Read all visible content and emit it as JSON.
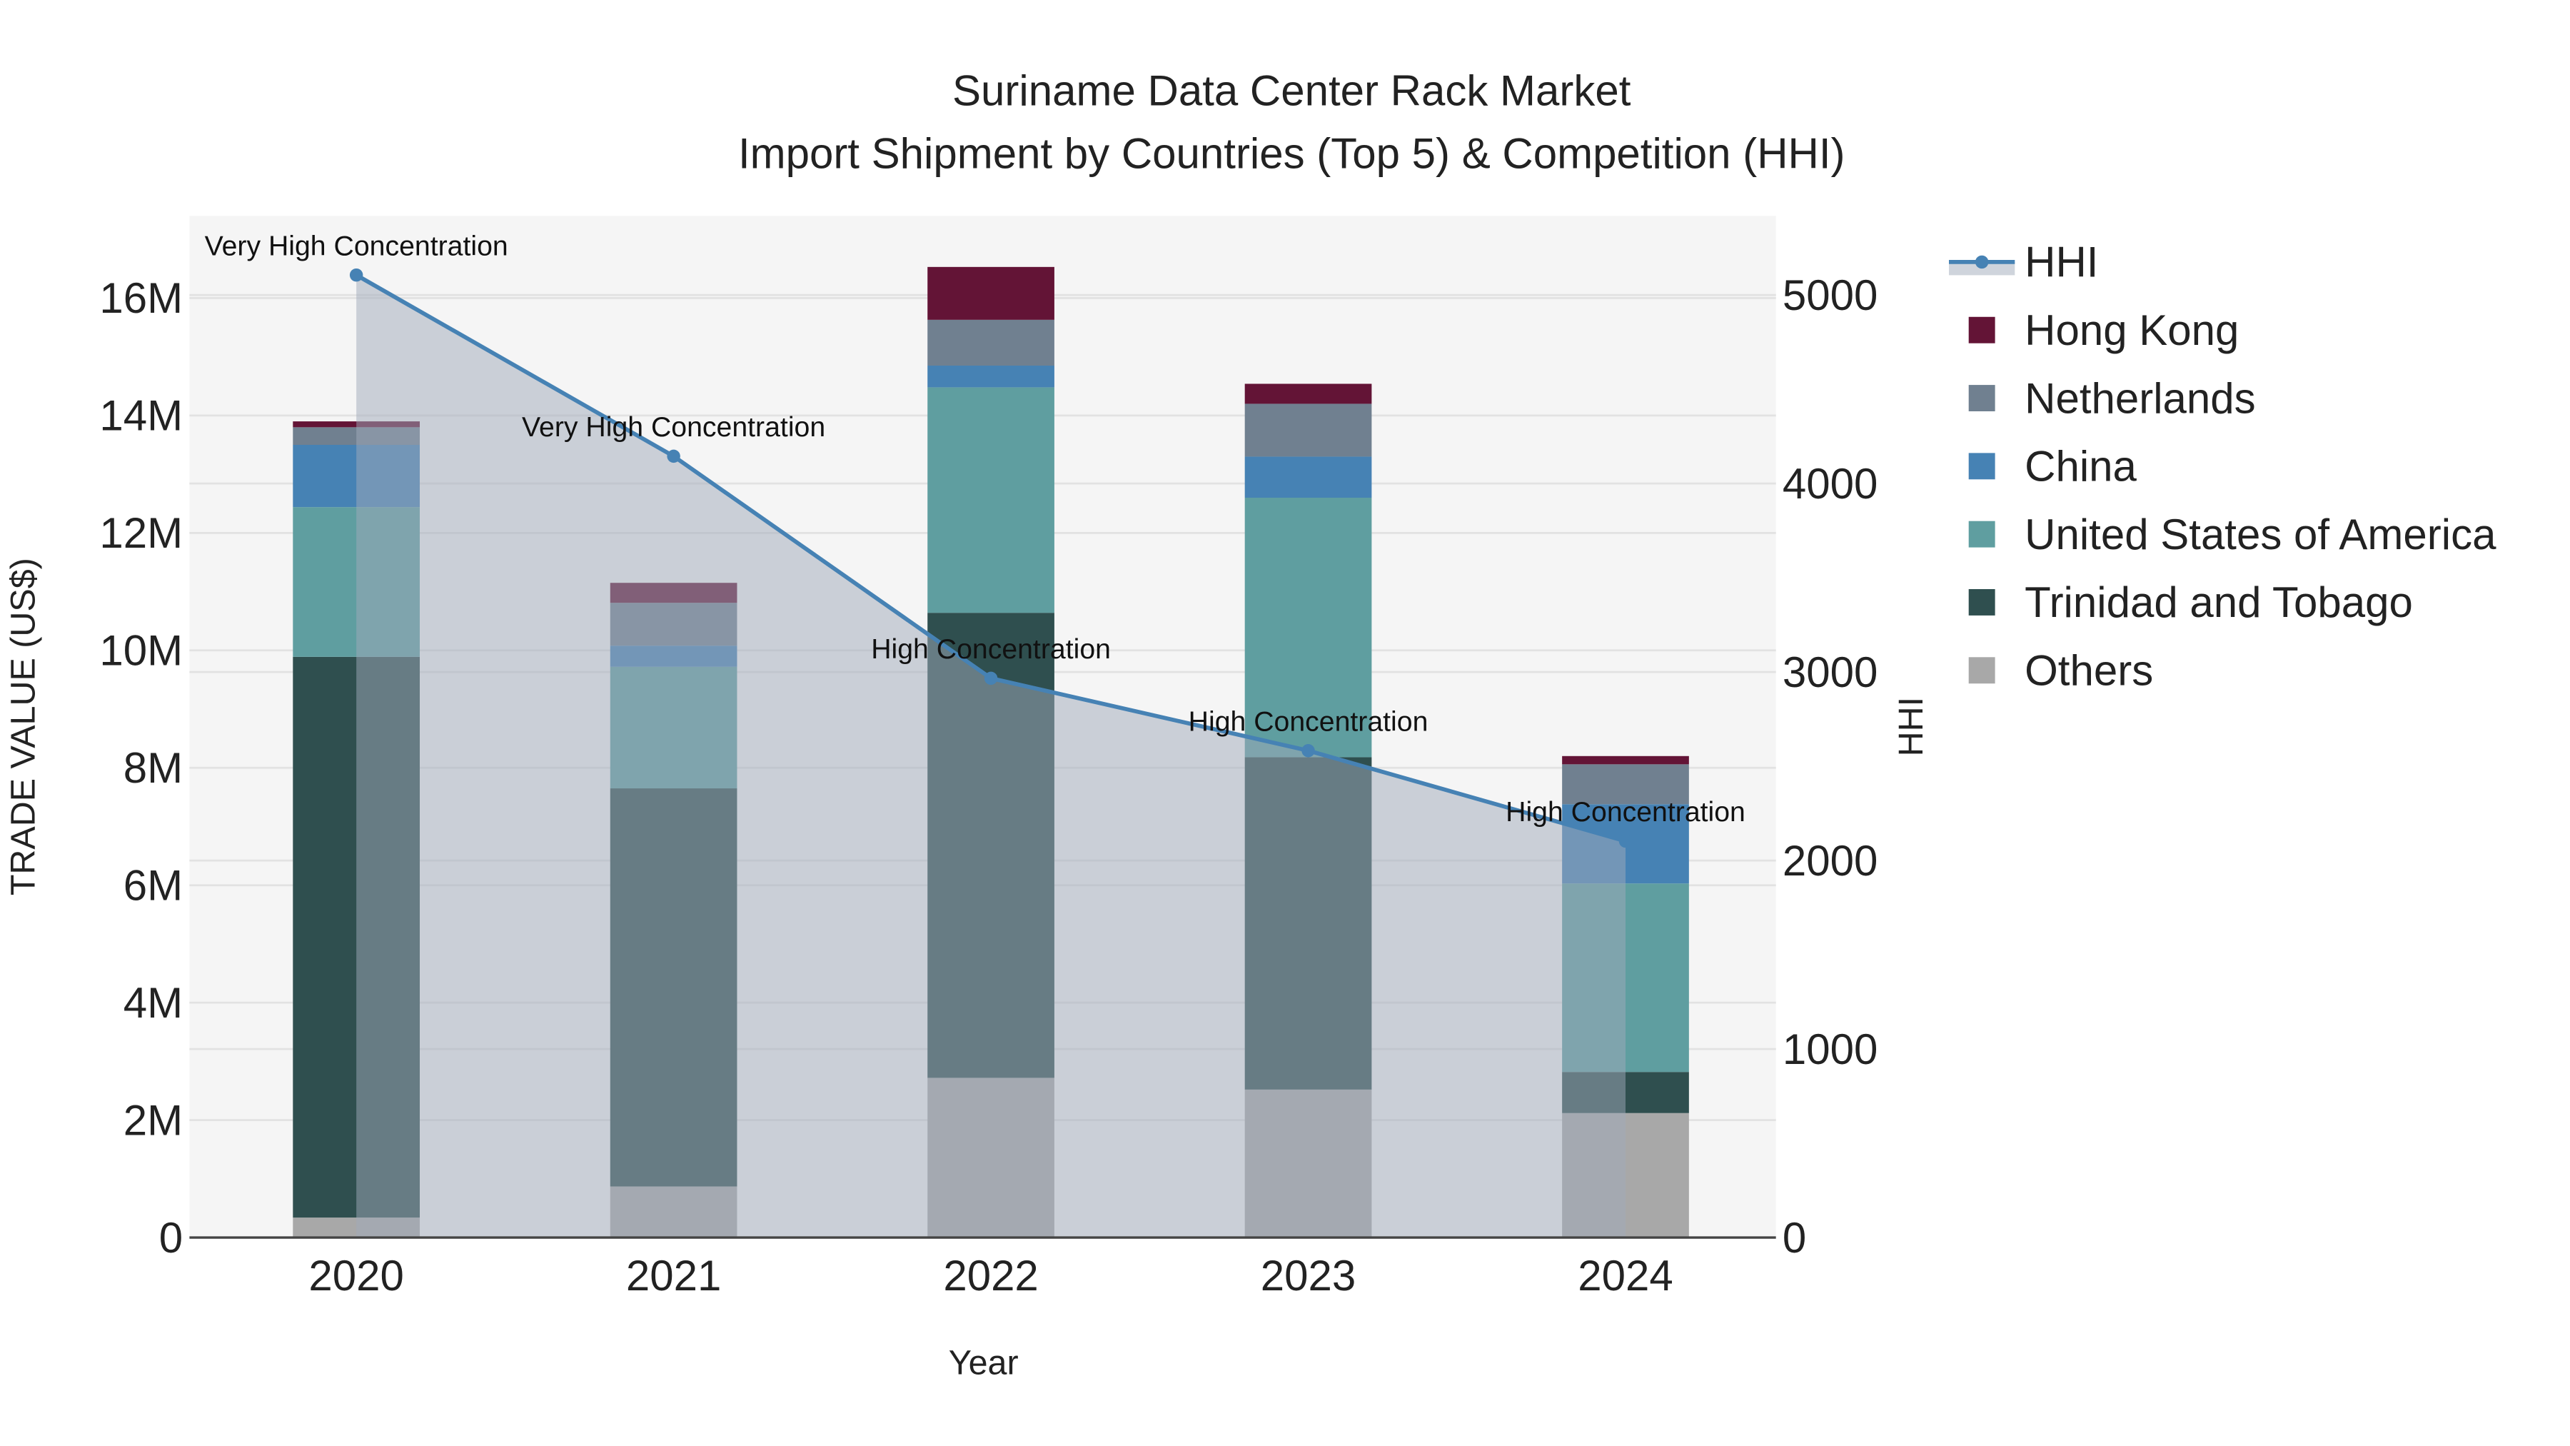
{
  "chart_data": {
    "type": "bar",
    "title_line1": "Suriname Data Center Rack Market",
    "title_line2": "Import Shipment by Countries (Top 5) & Competition (HHI)",
    "xlabel": "Year",
    "ylabel": "TRADE VALUE (US$)",
    "y2label": "HHI",
    "categories": [
      "2020",
      "2021",
      "2022",
      "2023",
      "2024"
    ],
    "ylim": [
      0,
      17400000
    ],
    "y2lim": [
      0,
      5420
    ],
    "yticks": [
      0,
      2000000,
      4000000,
      6000000,
      8000000,
      10000000,
      12000000,
      14000000,
      16000000
    ],
    "ytick_labels": [
      "0",
      "2M",
      "4M",
      "6M",
      "8M",
      "10M",
      "12M",
      "14M",
      "16M"
    ],
    "y2ticks": [
      0,
      1000,
      2000,
      3000,
      4000,
      5000
    ],
    "y2tick_labels": [
      "0",
      "1000",
      "2000",
      "3000",
      "4000",
      "5000"
    ],
    "series": [
      {
        "name": "Others",
        "color": "#a8a8a8",
        "values": [
          340000,
          870000,
          2720000,
          2520000,
          2120000
        ]
      },
      {
        "name": "Trinidad and Tobago",
        "color": "#2f4f4f",
        "values": [
          9550000,
          6780000,
          7920000,
          5660000,
          700000
        ]
      },
      {
        "name": "United States of America",
        "color": "#5f9ea0",
        "values": [
          2550000,
          2070000,
          3840000,
          4420000,
          3210000
        ]
      },
      {
        "name": "China",
        "color": "#4682b4",
        "values": [
          1060000,
          360000,
          370000,
          700000,
          1350000
        ]
      },
      {
        "name": "Netherlands",
        "color": "#708090",
        "values": [
          300000,
          730000,
          780000,
          900000,
          680000
        ]
      },
      {
        "name": "Hong Kong",
        "color": "#631436",
        "values": [
          100000,
          340000,
          900000,
          340000,
          140000
        ]
      }
    ],
    "hhi": {
      "name": "HHI",
      "color": "#4682b4",
      "values": [
        5106,
        4145,
        2967,
        2583,
        2103
      ],
      "annotations": [
        "Very High Concentration",
        "Very High Concentration",
        "High Concentration",
        "High Concentration",
        "High Concentration"
      ]
    },
    "legend_order": [
      "HHI",
      "Hong Kong",
      "Netherlands",
      "China",
      "United States of America",
      "Trinidad and Tobago",
      "Others"
    ],
    "legend_position": "right",
    "grid": true
  }
}
